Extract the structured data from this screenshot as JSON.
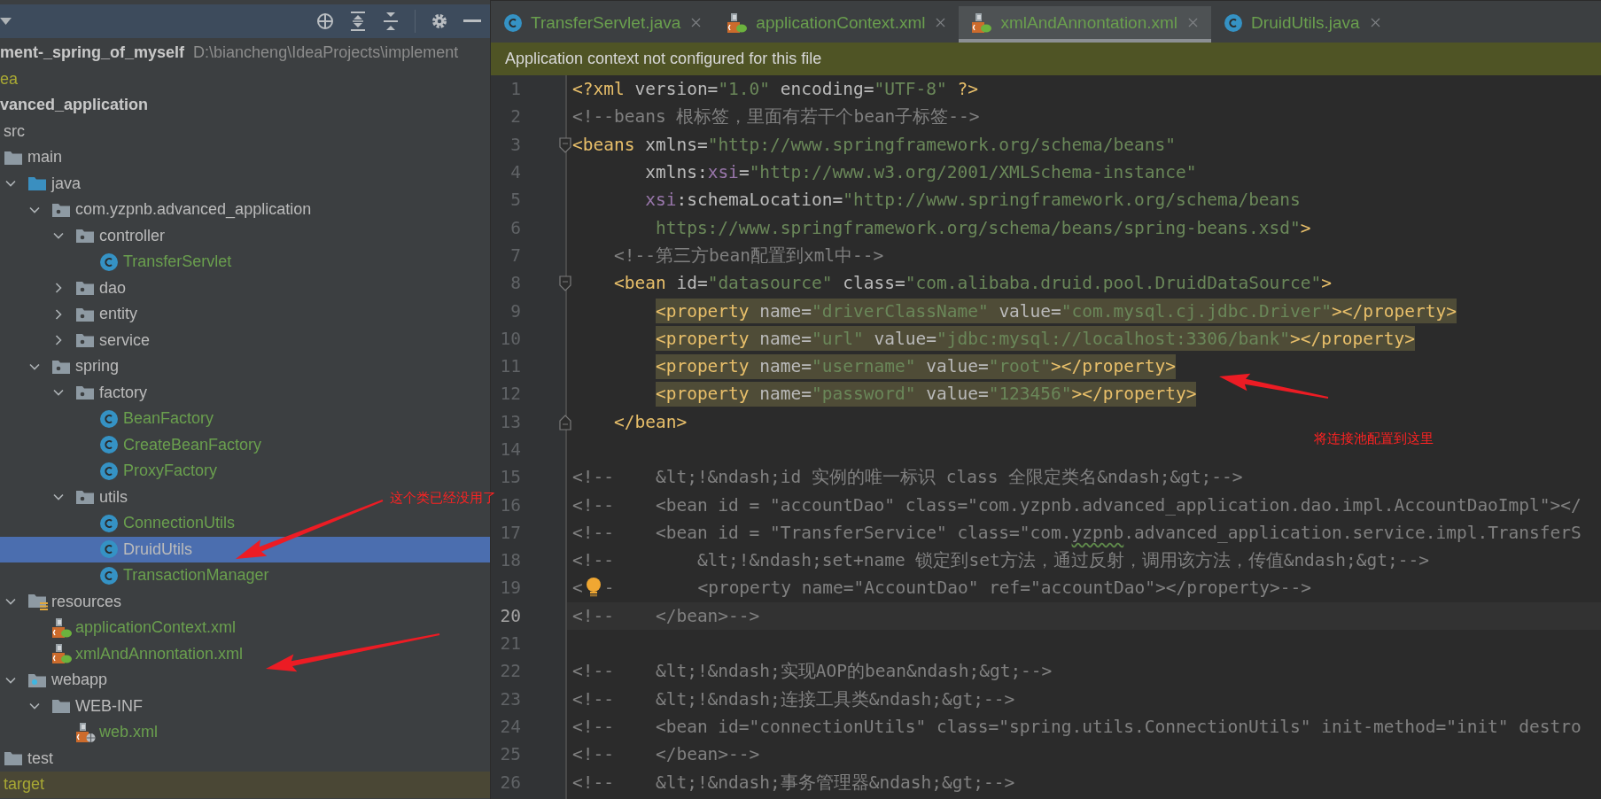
{
  "project_tree": {
    "items": [
      {
        "kind": "module",
        "label": "ment-_spring_of_myself",
        "path": "D:\\biancheng\\IdeaProjects\\implement",
        "color": "#bbbbbb",
        "selected": false,
        "children": [
          {
            "kind": "plain",
            "label": "ea",
            "color": "#a8a834",
            "selected": false
          },
          {
            "kind": "module",
            "label": "vanced_application",
            "color": "#bbbbbb",
            "selected": false,
            "children": [
              {
                "kind": "plain",
                "label": "src",
                "color": "#bbbbbb",
                "selected": false,
                "children": [
                  {
                    "kind": "folder",
                    "label": "main",
                    "color": "#bbbbbb",
                    "selected": false,
                    "children": [
                      {
                        "kind": "source-root",
                        "label": "java",
                        "expanded": true,
                        "color": "#bbbbbb",
                        "selected": false,
                        "children": [
                          {
                            "kind": "package",
                            "label": "com.yzpnb.advanced_application",
                            "expanded": true,
                            "color": "#bbbbbb",
                            "selected": false,
                            "children": [
                              {
                                "kind": "package",
                                "label": "controller",
                                "expanded": true,
                                "color": "#bbbbbb",
                                "selected": false,
                                "children": [
                                  {
                                    "kind": "class",
                                    "label": "TransferServlet",
                                    "color": "#6a9f4e",
                                    "selected": false
                                  }
                                ]
                              },
                              {
                                "kind": "package",
                                "label": "dao",
                                "expanded": false,
                                "color": "#bbbbbb",
                                "selected": false
                              },
                              {
                                "kind": "package",
                                "label": "entity",
                                "expanded": false,
                                "color": "#bbbbbb",
                                "selected": false
                              },
                              {
                                "kind": "package",
                                "label": "service",
                                "expanded": false,
                                "color": "#bbbbbb",
                                "selected": false
                              }
                            ]
                          },
                          {
                            "kind": "package",
                            "label": "spring",
                            "expanded": true,
                            "color": "#bbbbbb",
                            "selected": false,
                            "children": [
                              {
                                "kind": "package",
                                "label": "factory",
                                "expanded": true,
                                "color": "#bbbbbb",
                                "selected": false,
                                "children": [
                                  {
                                    "kind": "class",
                                    "label": "BeanFactory",
                                    "color": "#6a9f4e",
                                    "selected": false
                                  },
                                  {
                                    "kind": "class",
                                    "label": "CreateBeanFactory",
                                    "color": "#6a9f4e",
                                    "selected": false
                                  },
                                  {
                                    "kind": "class",
                                    "label": "ProxyFactory",
                                    "color": "#6a9f4e",
                                    "selected": false
                                  }
                                ]
                              },
                              {
                                "kind": "package",
                                "label": "utils",
                                "expanded": true,
                                "color": "#bbbbbb",
                                "selected": false,
                                "children": [
                                  {
                                    "kind": "class",
                                    "label": "ConnectionUtils",
                                    "color": "#6a9f4e",
                                    "selected": false
                                  },
                                  {
                                    "kind": "class",
                                    "label": "DruidUtils",
                                    "selected": true
                                  },
                                  {
                                    "kind": "class",
                                    "label": "TransactionManager",
                                    "color": "#6a9f4e",
                                    "selected": false
                                  }
                                ]
                              }
                            ]
                          }
                        ]
                      },
                      {
                        "kind": "resources-root",
                        "label": "resources",
                        "expanded": true,
                        "color": "#bbbbbb",
                        "selected": false,
                        "children": [
                          {
                            "kind": "xml-spring",
                            "label": "applicationContext.xml",
                            "color": "#6a9f4e",
                            "selected": false
                          },
                          {
                            "kind": "xml-spring",
                            "label": "xmlAndAnnontation.xml",
                            "color": "#6a9f4e",
                            "selected": false
                          }
                        ]
                      },
                      {
                        "kind": "web-root",
                        "label": "webapp",
                        "expanded": true,
                        "color": "#bbbbbb",
                        "selected": false,
                        "children": [
                          {
                            "kind": "folder",
                            "label": "WEB-INF",
                            "expanded": true,
                            "color": "#bbbbbb",
                            "selected": false,
                            "children": [
                              {
                                "kind": "xml-web",
                                "label": "web.xml",
                                "color": "#6a9f4e",
                                "selected": false
                              }
                            ]
                          }
                        ]
                      }
                    ]
                  },
                  {
                    "kind": "folder",
                    "label": "test",
                    "color": "#bbbbbb",
                    "selected": false
                  }
                ]
              },
              {
                "kind": "excluded",
                "label": "target",
                "color": "#a8a834",
                "selected": false
              }
            ]
          }
        ]
      }
    ]
  },
  "editor": {
    "tabs": [
      {
        "kind": "class",
        "label": "TransferServlet.java",
        "selected": false
      },
      {
        "kind": "xml-spring",
        "label": "applicationContext.xml",
        "selected": false
      },
      {
        "kind": "xml-spring",
        "label": "xmlAndAnnontation.xml",
        "selected": true
      },
      {
        "kind": "class",
        "label": "DruidUtils.java",
        "selected": false
      }
    ],
    "banner": "Application context not configured for this file",
    "lines": [
      {
        "n": "1",
        "segments": [
          {
            "kind": "tag",
            "text": "<?xml"
          },
          {
            "kind": "attr",
            "text": " version="
          },
          {
            "kind": "value",
            "text": "\"1.0\""
          },
          {
            "kind": "attr",
            "text": " encoding="
          },
          {
            "kind": "value",
            "text": "\"UTF-8\""
          },
          {
            "kind": "tag",
            "text": " ?>"
          }
        ]
      },
      {
        "n": "2",
        "segments": [
          {
            "kind": "comment",
            "text": "<!--beans 根标签，里面有若干个bean子标签-->"
          }
        ]
      },
      {
        "n": "3",
        "fold_open": true,
        "segments": [
          {
            "kind": "tag",
            "text": "<beans"
          },
          {
            "kind": "attr",
            "text": " xmlns="
          },
          {
            "kind": "value",
            "text": "\"http://www.springframework.org/schema/beans\""
          }
        ]
      },
      {
        "n": "4",
        "segments": [
          {
            "kind": "attr",
            "text": "       xmlns:"
          },
          {
            "kind": "ns",
            "text": "xsi"
          },
          {
            "kind": "attr",
            "text": "="
          },
          {
            "kind": "value",
            "text": "\"http://www.w3.org/2001/XMLSchema-instance\""
          }
        ]
      },
      {
        "n": "5",
        "segments": [
          {
            "kind": "ns",
            "text": "       xsi"
          },
          {
            "kind": "attr",
            "text": ":schemaLocation="
          },
          {
            "kind": "value",
            "text": "\"http://www.springframework.org/schema/beans"
          }
        ]
      },
      {
        "n": "6",
        "segments": [
          {
            "kind": "value",
            "text": "        https://www.springframework.org/schema/beans/spring-beans.xsd\""
          },
          {
            "kind": "tag",
            "text": ">"
          }
        ]
      },
      {
        "n": "7",
        "segments": [
          {
            "kind": "comment",
            "text": "    <!--第三方bean配置到xml中-->"
          }
        ]
      },
      {
        "n": "8",
        "fold_open": true,
        "segments": [
          {
            "kind": "tag",
            "text": "    <bean"
          },
          {
            "kind": "attr",
            "text": " id="
          },
          {
            "kind": "value",
            "text": "\"datasource\""
          },
          {
            "kind": "attr",
            "text": " class="
          },
          {
            "kind": "value",
            "text": "\"com.alibaba.druid.pool.DruidDataSource\""
          },
          {
            "kind": "tag",
            "text": ">"
          }
        ]
      },
      {
        "n": "9",
        "highlighted": true,
        "segments": [
          {
            "kind": "tag",
            "text": "        <property"
          },
          {
            "kind": "attr",
            "text": " name="
          },
          {
            "kind": "value",
            "text": "\"driverClassName\""
          },
          {
            "kind": "attr",
            "text": " value="
          },
          {
            "kind": "value",
            "text": "\"com.mysql.cj.jdbc.Driver\""
          },
          {
            "kind": "tag",
            "text": "></property>"
          }
        ]
      },
      {
        "n": "10",
        "highlighted": true,
        "segments": [
          {
            "kind": "tag",
            "text": "        <property"
          },
          {
            "kind": "attr",
            "text": " name="
          },
          {
            "kind": "value",
            "text": "\"url\""
          },
          {
            "kind": "attr",
            "text": " value="
          },
          {
            "kind": "value",
            "text": "\"jdbc:mysql://localhost:3306/bank\""
          },
          {
            "kind": "tag",
            "text": "></property>"
          }
        ]
      },
      {
        "n": "11",
        "highlighted": true,
        "segments": [
          {
            "kind": "tag",
            "text": "        <property"
          },
          {
            "kind": "attr",
            "text": " name="
          },
          {
            "kind": "value",
            "text": "\"username\""
          },
          {
            "kind": "attr",
            "text": " value="
          },
          {
            "kind": "value",
            "text": "\"root\""
          },
          {
            "kind": "tag",
            "text": "></property>"
          }
        ]
      },
      {
        "n": "12",
        "highlighted": true,
        "segments": [
          {
            "kind": "tag",
            "text": "        <property"
          },
          {
            "kind": "attr",
            "text": " name="
          },
          {
            "kind": "value",
            "text": "\"password\""
          },
          {
            "kind": "attr",
            "text": " value="
          },
          {
            "kind": "value",
            "text": "\"123456\""
          },
          {
            "kind": "tag",
            "text": "></property>"
          }
        ]
      },
      {
        "n": "13",
        "fold_close": true,
        "segments": [
          {
            "kind": "tag",
            "text": "    </bean>"
          }
        ]
      },
      {
        "n": "14"
      },
      {
        "n": "15",
        "segments": [
          {
            "kind": "comment",
            "text": "<!--    &lt;!&ndash;id 实例的唯一标识 class 全限定类名&ndash;&gt;-->"
          }
        ]
      },
      {
        "n": "16",
        "segments": [
          {
            "kind": "comment",
            "text": "<!--    <bean id = \"accountDao\" class=\"com.yzpnb.advanced_application.dao.impl.AccountDaoImpl\"></"
          }
        ]
      },
      {
        "n": "17",
        "segments": [
          {
            "kind": "comment",
            "text": "<!--    <bean id = \"TransferService\" class=\"com."
          },
          {
            "kind": "typo",
            "text": "yzpnb"
          },
          {
            "kind": "comment",
            "text": ".advanced_application.service.impl.TransferS"
          }
        ]
      },
      {
        "n": "18",
        "segments": [
          {
            "kind": "comment",
            "text": "<!--        &lt;!&ndash;set+name 锁定到set方法，通过反射，调用该方法，传值&ndash;&gt;-->"
          }
        ]
      },
      {
        "n": "19",
        "segments": [
          {
            "kind": "comment",
            "text": "<"
          },
          {
            "kind": "bulb"
          },
          {
            "kind": "comment",
            "text": "-        <property name=\"AccountDao\" ref=\"accountDao\"></property>-->"
          }
        ]
      },
      {
        "n": "20",
        "current": true,
        "segments": [
          {
            "kind": "comment",
            "text": "<!--    </bean>-->"
          }
        ]
      },
      {
        "n": "21"
      },
      {
        "n": "22",
        "segments": [
          {
            "kind": "comment",
            "text": "<!--    &lt;!&ndash;实现AOP的bean&ndash;&gt;-->"
          }
        ]
      },
      {
        "n": "23",
        "segments": [
          {
            "kind": "comment",
            "text": "<!--    &lt;!&ndash;连接工具类&ndash;&gt;-->"
          }
        ]
      },
      {
        "n": "24",
        "segments": [
          {
            "kind": "comment",
            "text": "<!--    <bean id=\"connectionUtils\" class=\"spring.utils.ConnectionUtils\" init-method=\"init\" destro"
          }
        ]
      },
      {
        "n": "25",
        "segments": [
          {
            "kind": "comment",
            "text": "<!--    </bean>-->"
          }
        ]
      },
      {
        "n": "26",
        "segments": [
          {
            "kind": "comment",
            "text": "<!--    &lt;!&ndash;事务管理器&ndash;&gt;-->"
          }
        ]
      }
    ]
  },
  "annotations": [
    {
      "text": "这个类已经没用了"
    },
    {
      "text": "将连接池配置到这里"
    }
  ]
}
